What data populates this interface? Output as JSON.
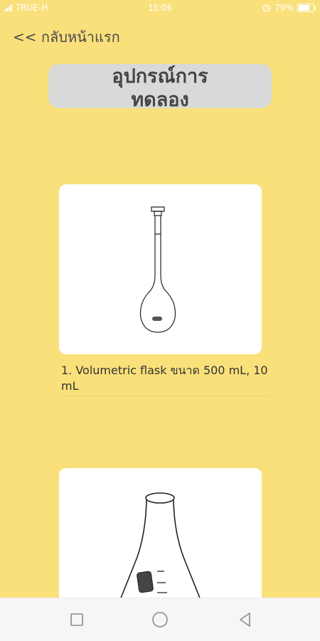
{
  "status_bar": {
    "carrier": "TRUE-H",
    "time": "15:06",
    "battery_percent": "79%",
    "battery_level": 0.79,
    "icons": [
      "signal-icon",
      "alarm-icon",
      "battery-icon"
    ]
  },
  "nav": {
    "back_label": "<< กลับหน้าแรก"
  },
  "title": {
    "line1": "อุปกรณ์การ",
    "line2": "ทดลอง"
  },
  "items": [
    {
      "caption": "1. Volumetric flask ขนาด 500 mL, 10 mL",
      "image": "volumetric-flask-drawing"
    },
    {
      "caption": "",
      "image": "erlenmeyer-flask-drawing"
    }
  ],
  "navbar": {
    "icons": [
      "recents-square-icon",
      "home-circle-icon",
      "back-triangle-icon"
    ]
  },
  "colors": {
    "background": "#f9e07b",
    "title_box": "#d9d9d9",
    "text": "#444444"
  }
}
